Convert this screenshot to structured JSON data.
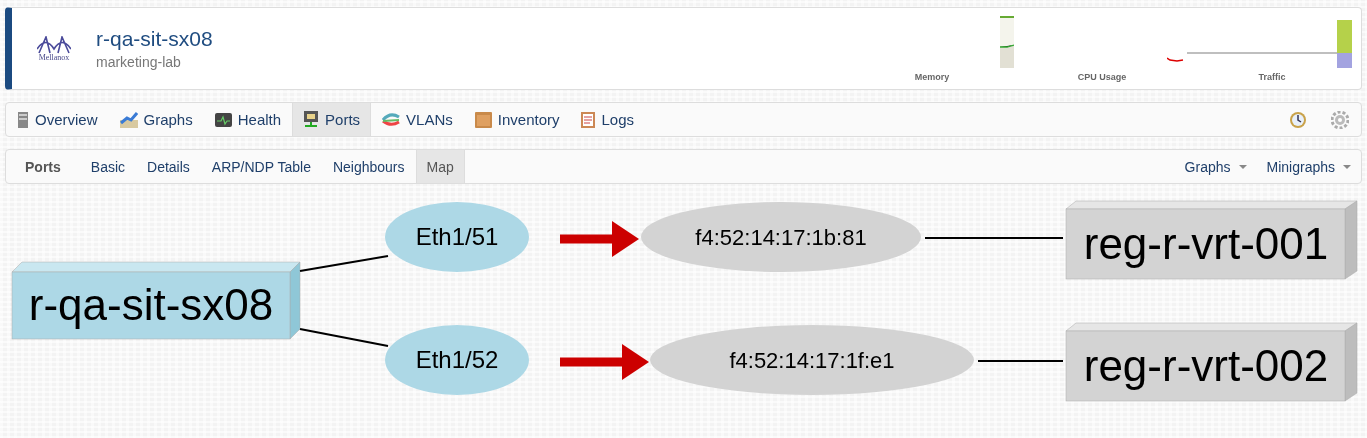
{
  "device": {
    "logo_text": "Mellanox",
    "title": "r-qa-sit-sx08",
    "location": "marketing-lab"
  },
  "minigraphs": [
    {
      "label": "Memory"
    },
    {
      "label": "CPU Usage"
    },
    {
      "label": "Traffic"
    }
  ],
  "nav": {
    "tabs": [
      {
        "label": "Overview",
        "selected": false
      },
      {
        "label": "Graphs",
        "selected": false
      },
      {
        "label": "Health",
        "selected": false
      },
      {
        "label": "Ports",
        "selected": true
      },
      {
        "label": "VLANs",
        "selected": false
      },
      {
        "label": "Inventory",
        "selected": false
      },
      {
        "label": "Logs",
        "selected": false
      }
    ]
  },
  "subnav": {
    "items": [
      {
        "label": "Ports",
        "kind": "heading",
        "selected": false
      },
      {
        "label": "Basic",
        "kind": "link",
        "selected": false
      },
      {
        "label": "Details",
        "kind": "link",
        "selected": false
      },
      {
        "label": "ARP/NDP Table",
        "kind": "link",
        "selected": false
      },
      {
        "label": "Neighbours",
        "kind": "link",
        "selected": false
      },
      {
        "label": "Map",
        "kind": "link",
        "selected": true
      }
    ],
    "menus": [
      {
        "label": "Graphs"
      },
      {
        "label": "Minigraphs"
      }
    ]
  },
  "map": {
    "device": "r-qa-sit-sx08",
    "links": [
      {
        "port": "Eth1/51",
        "neighbour": "f4:52:14:17:1b:81",
        "remote": "reg-r-vrt-001"
      },
      {
        "port": "Eth1/52",
        "neighbour": "f4:52:14:17:1f:e1",
        "remote": "reg-r-vrt-002"
      }
    ]
  }
}
